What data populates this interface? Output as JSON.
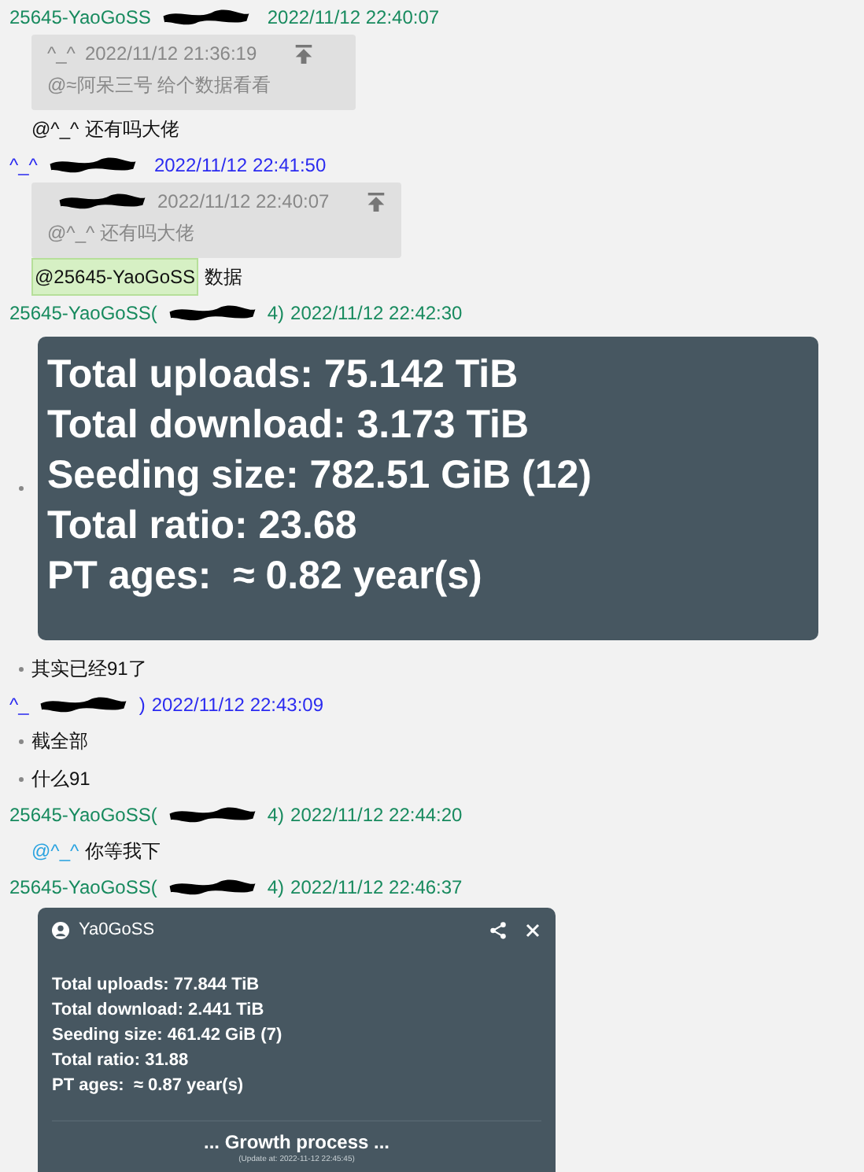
{
  "messages": [
    {
      "sender": "25645-YaoGoSS",
      "time": "2022/11/12 22:40:07",
      "color": "#178a5e",
      "body": [
        {
          "kind": "quote",
          "author": "^_^",
          "time": "2022/11/12 21:36:19",
          "text": "@≈阿呆三号 给个数据看看"
        },
        {
          "kind": "text",
          "bullet": false,
          "mention": {
            "text": "@^_^",
            "highlighted": false,
            "linked": false
          },
          "text": "还有吗大佬"
        }
      ]
    },
    {
      "sender": "^_^",
      "time": "2022/11/12 22:41:50",
      "color": "#2a2af0",
      "body": [
        {
          "kind": "quote",
          "time": "2022/11/12 22:40:07",
          "text": "@^_^ 还有吗大佬"
        },
        {
          "kind": "text",
          "bullet": false,
          "mention": {
            "text": "@25645-YaoGoSS",
            "highlighted": true,
            "linked": false
          },
          "text": "数据"
        }
      ]
    },
    {
      "sender": "25645-YaoGoSS(",
      "sender_tail": "4)",
      "time": "2022/11/12 22:42:30",
      "color": "#178a5e",
      "body": [
        {
          "kind": "big_card",
          "bullet": true,
          "lines": [
            "Total uploads: 75.142 TiB",
            "Total download: 3.173 TiB",
            "Seeding size: 782.51 GiB (12)",
            "Total ratio: 23.68",
            "PT ages:  ≈ 0.82 year(s)"
          ]
        },
        {
          "kind": "text",
          "bullet": true,
          "text": "其实已经91了"
        }
      ]
    },
    {
      "sender": "^_",
      "sender_tail": ")",
      "time": "2022/11/12 22:43:09",
      "color": "#2a2af0",
      "body": [
        {
          "kind": "text",
          "bullet": true,
          "text": "截全部"
        },
        {
          "kind": "text",
          "bullet": true,
          "text": "什么91"
        }
      ]
    },
    {
      "sender": "25645-YaoGoSS(",
      "sender_tail": "4)",
      "time": "2022/11/12 22:44:20",
      "color": "#178a5e",
      "body": [
        {
          "kind": "text",
          "bullet": false,
          "mention": {
            "text": "@^_^",
            "highlighted": false,
            "linked": true
          },
          "text": "你等我下"
        }
      ]
    },
    {
      "sender": "25645-YaoGoSS(",
      "sender_tail": "4)",
      "time": "2022/11/12 22:46:37",
      "color": "#178a5e",
      "body": [
        {
          "kind": "small_card",
          "title": "Ya0GoSS",
          "lines": [
            "Total uploads: 77.844 TiB",
            "Total download: 2.441 TiB",
            "Seeding size: 461.42 GiB (7)",
            "Total ratio: 31.88",
            "PT ages:  ≈ 0.87 year(s)"
          ],
          "footer": "... Growth process ...",
          "update": "(Update at: 2022-11-12 22:45:45)"
        }
      ]
    }
  ]
}
